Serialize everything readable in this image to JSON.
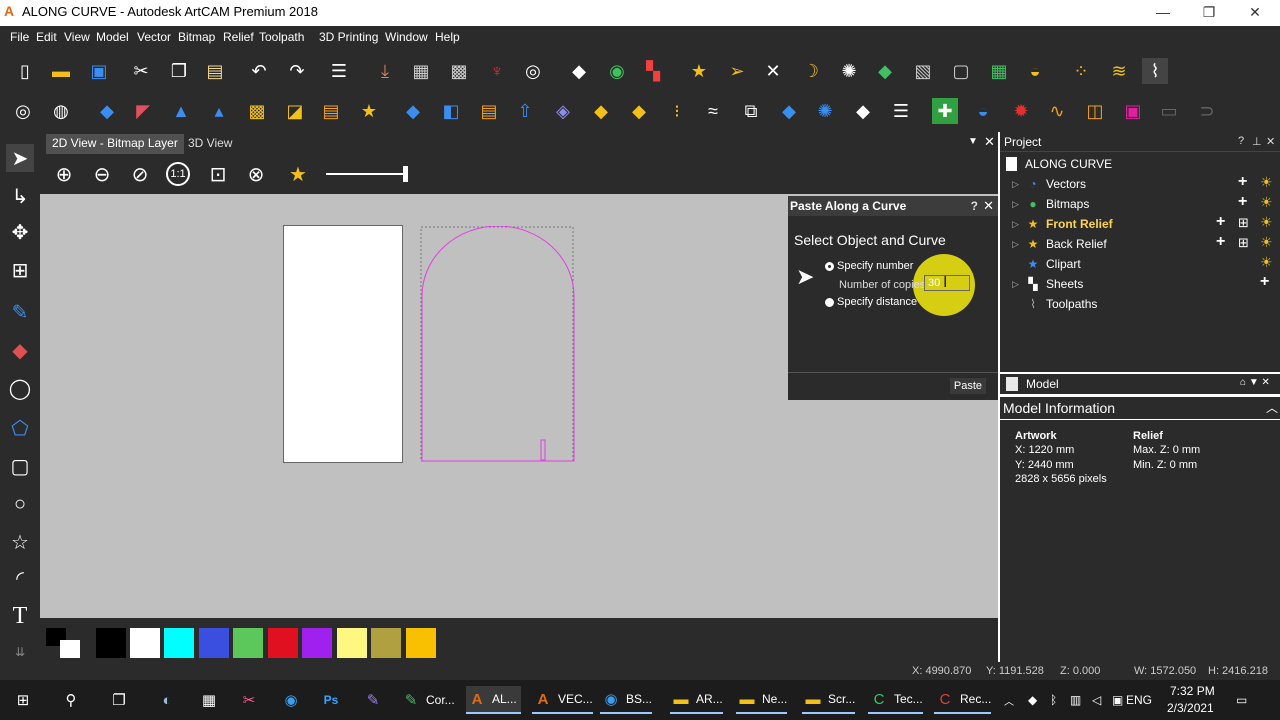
{
  "window": {
    "title": "ALONG CURVE - Autodesk ArtCAM Premium 2018",
    "controls": [
      "—",
      "❐",
      "✕"
    ]
  },
  "menu": [
    "File",
    "Edit",
    "View",
    "Model",
    "Vector",
    "Bitmap",
    "Relief",
    "Toolpath",
    "3D Printing",
    "Window",
    "Help"
  ],
  "view_tabs": [
    "2D View - Bitmap Layer",
    "3D View"
  ],
  "dialog": {
    "title": "Paste Along a Curve",
    "help": "?",
    "subtitle": "Select Object and Curve",
    "specify_number": "Specify number",
    "number_of_copies_label": "Number of copies",
    "number_of_copies_value": "30",
    "specify_distance": "Specify distance",
    "paste_button": "Paste"
  },
  "project": {
    "header": "Project",
    "root": "ALONG CURVE",
    "items": [
      {
        "label": "Vectors"
      },
      {
        "label": "Bitmaps"
      },
      {
        "label": "Front Relief"
      },
      {
        "label": "Back Relief"
      },
      {
        "label": "Clipart"
      },
      {
        "label": "Sheets"
      },
      {
        "label": "Toolpaths"
      }
    ]
  },
  "model": {
    "header": "Model",
    "info_header": "Model Information",
    "artwork_label": "Artwork",
    "relief_label": "Relief",
    "x": "X: 1220 mm",
    "y": "Y: 2440 mm",
    "pixels": "2828 x 5656 pixels",
    "max_z": "Max. Z: 0 mm",
    "min_z": "Min. Z: 0 mm"
  },
  "palette": [
    "#000000",
    "#ffffff",
    "#00ffff",
    "#3a4fe0",
    "#5cc85c",
    "#e01020",
    "#a020f0",
    "#fff880",
    "#b0a040",
    "#f8c000"
  ],
  "status": {
    "x": "X: 4990.870",
    "y": "Y: 1191.528",
    "z": "Z: 0.000",
    "w": "W: 1572.050",
    "h": "H: 2416.218"
  },
  "taskbar": {
    "apps": [
      {
        "label": "Cor..."
      },
      {
        "label": "AL..."
      },
      {
        "label": "VEC..."
      },
      {
        "label": "BS..."
      },
      {
        "label": "AR..."
      },
      {
        "label": "Ne..."
      },
      {
        "label": "Scr..."
      },
      {
        "label": "Tec..."
      },
      {
        "label": "Rec..."
      }
    ],
    "lang": "ENG",
    "time": "7:32 PM",
    "date": "2/3/2021"
  }
}
